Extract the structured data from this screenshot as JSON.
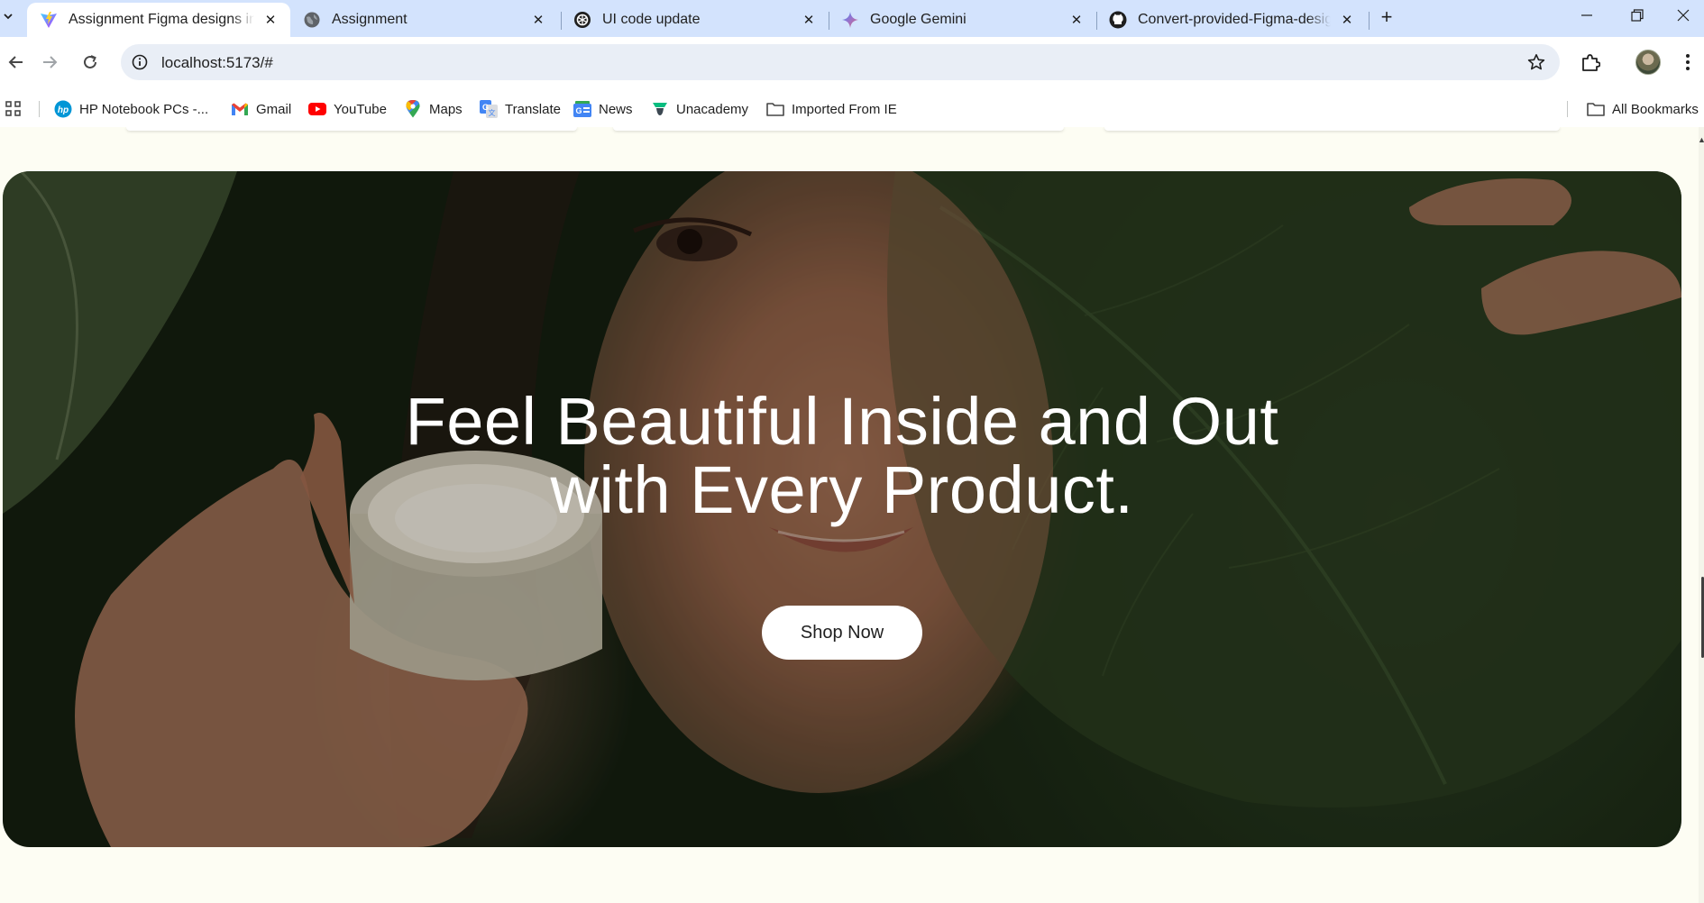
{
  "browser": {
    "tabs": [
      {
        "title": "Assignment Figma designs into",
        "active": true,
        "icon": "vite-icon"
      },
      {
        "title": "Assignment",
        "active": false,
        "icon": "globe-icon"
      },
      {
        "title": "UI code update",
        "active": false,
        "icon": "chatgpt-icon"
      },
      {
        "title": "Google Gemini",
        "active": false,
        "icon": "gemini-icon"
      },
      {
        "title": "Convert-provided-Figma-design",
        "active": false,
        "icon": "github-icon"
      }
    ],
    "url": "localhost:5173/#",
    "bookmarks": [
      {
        "label": "HP Notebook PCs -...",
        "icon": "hp-icon"
      },
      {
        "label": "Gmail",
        "icon": "gmail-icon"
      },
      {
        "label": "YouTube",
        "icon": "youtube-icon"
      },
      {
        "label": "Maps",
        "icon": "maps-icon"
      },
      {
        "label": "Translate",
        "icon": "translate-icon"
      },
      {
        "label": "News",
        "icon": "news-icon"
      },
      {
        "label": "Unacademy",
        "icon": "unacademy-icon"
      },
      {
        "label": "Imported From IE",
        "icon": "folder-icon"
      }
    ],
    "all_bookmarks_label": "All Bookmarks"
  },
  "hero": {
    "title_line1": "Feel Beautiful Inside and Out",
    "title_line2": "with Every Product.",
    "cta_label": "Shop Now"
  },
  "colors": {
    "page_background": "#fdfdf3",
    "tab_strip": "#d3e3fd",
    "omnibox": "#e9eef6",
    "cta_background": "#ffffff"
  }
}
